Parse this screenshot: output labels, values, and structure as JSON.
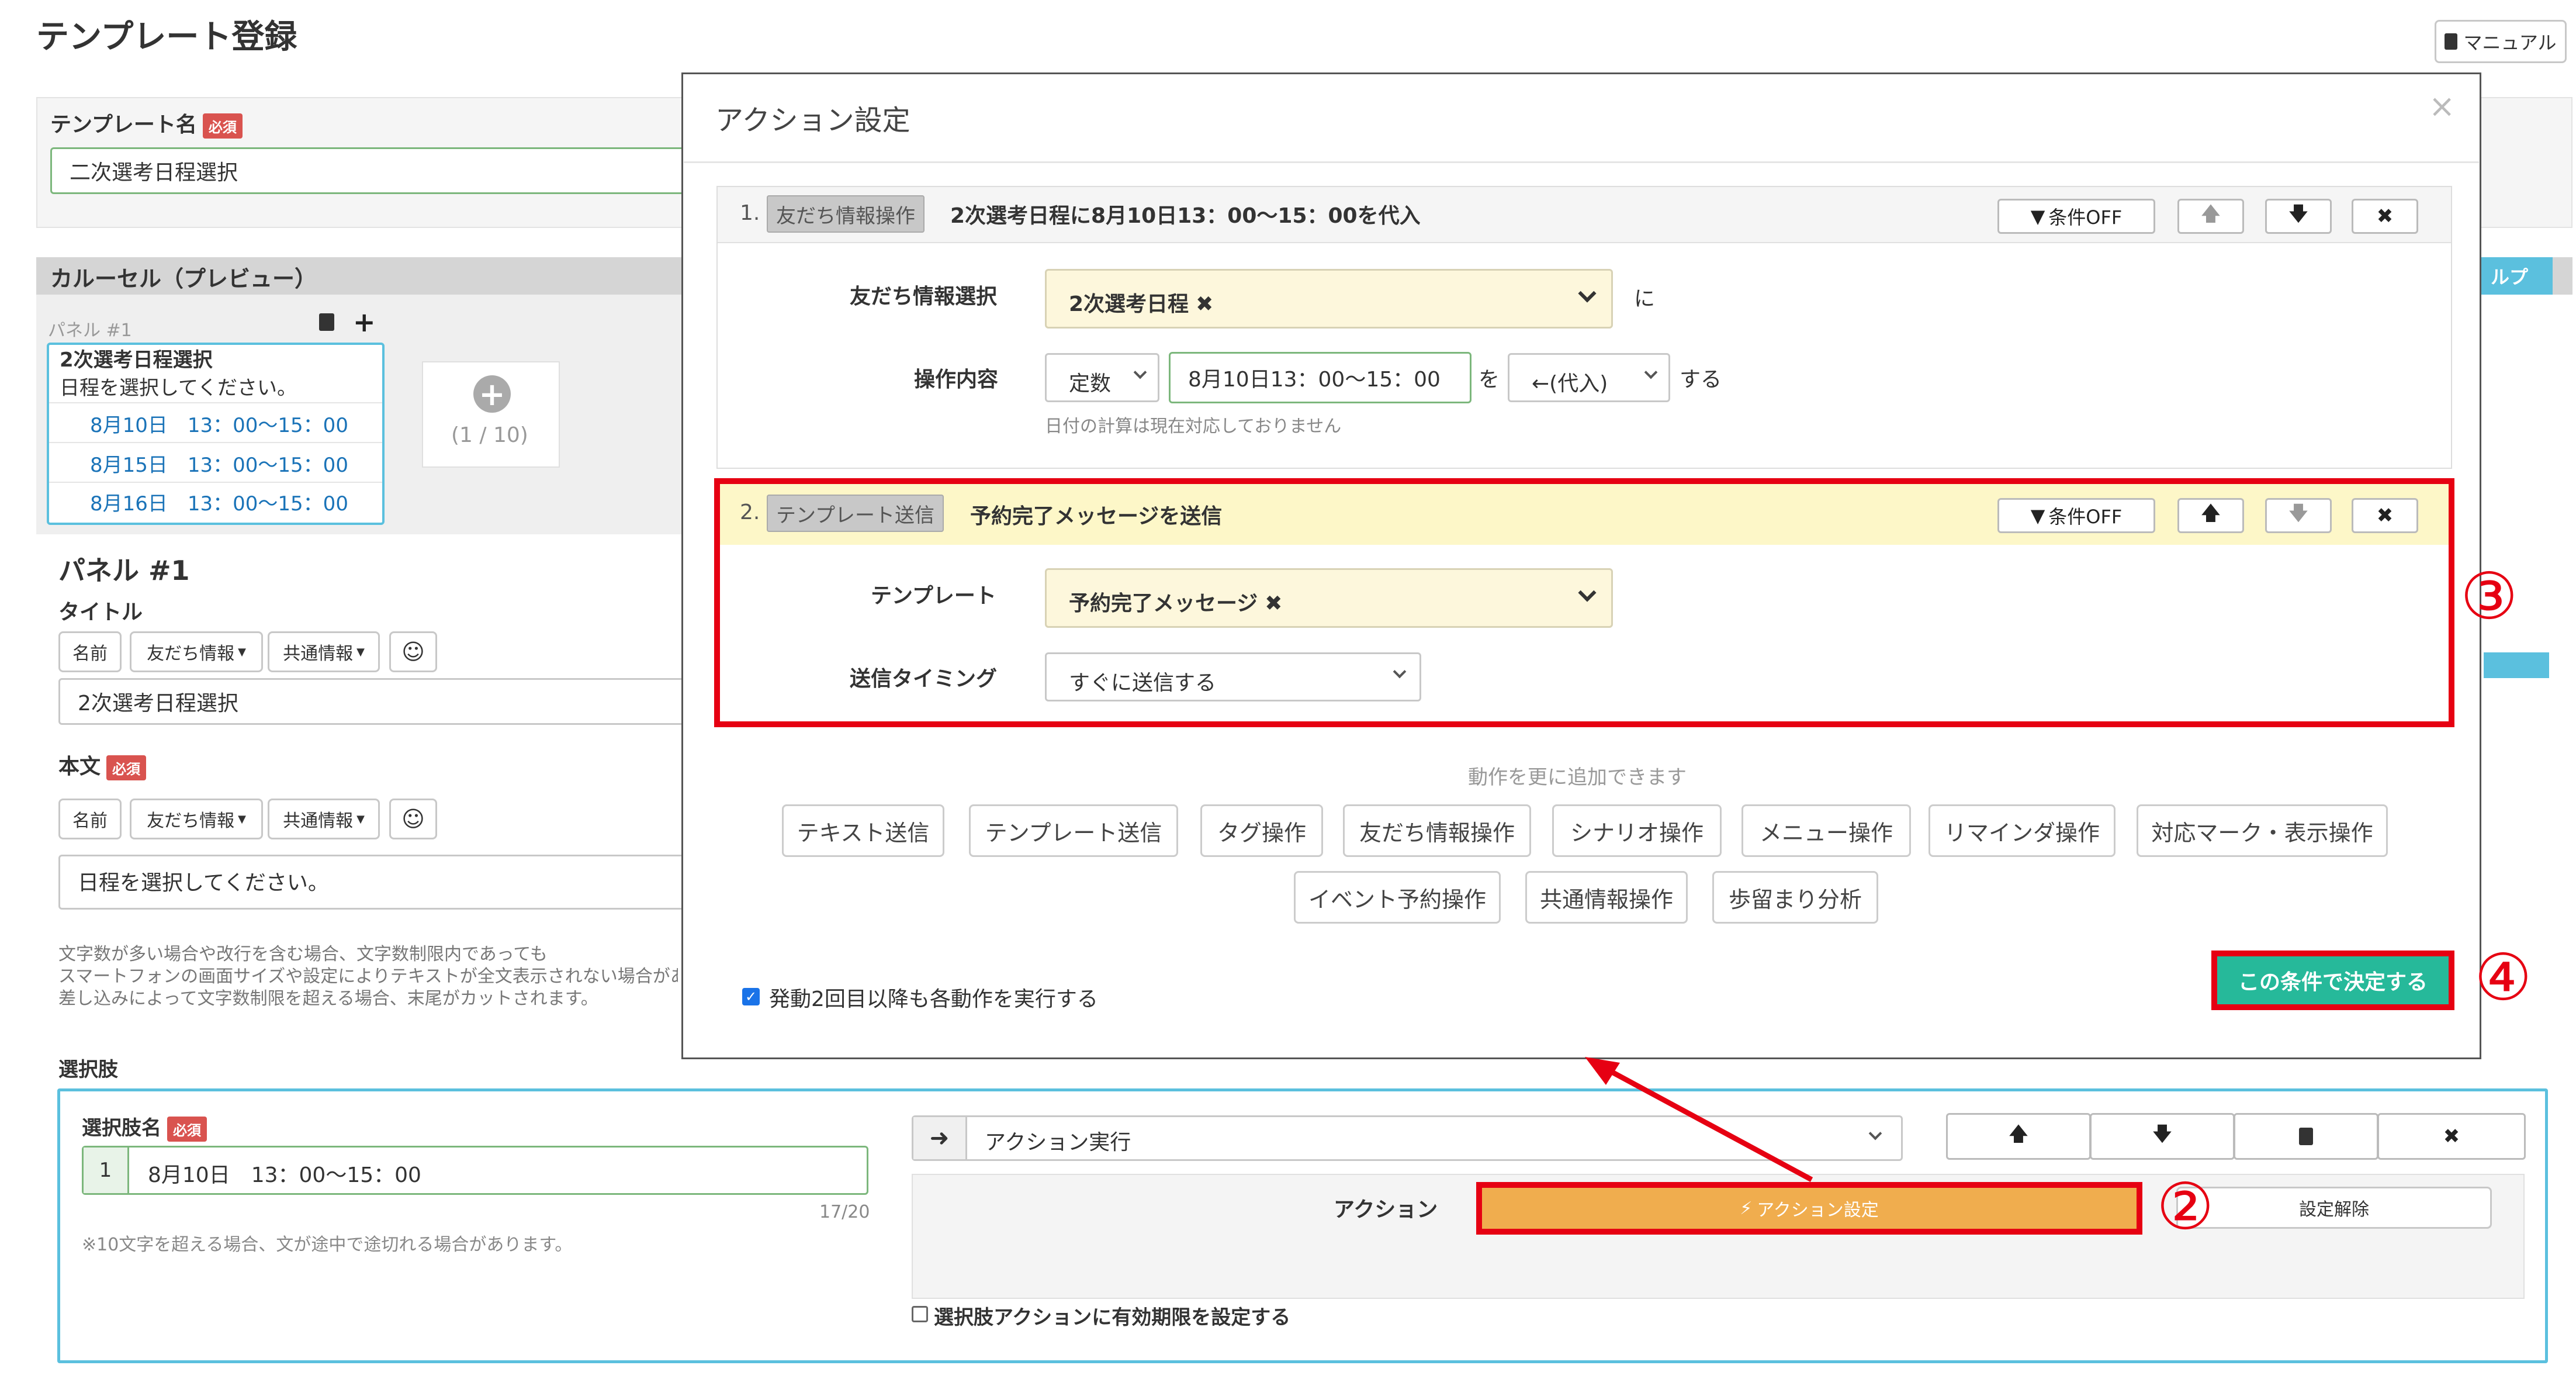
{
  "page": {
    "title": "テンプレート登録",
    "manual_label": "マニュアル",
    "template_name_label": "テンプレート名",
    "required": "必須",
    "template_name_value": "二次選考日程選択",
    "carousel_label": "カルーセル（プレビュー）",
    "help_label": "ルプ",
    "panel_small_label": "パネル #1",
    "preview_card": {
      "title": "2次選考日程選択",
      "subtitle": "日程を選択してください。",
      "options": [
        "8月10日　13：00〜15：00",
        "8月15日　13：00〜15：00",
        "8月16日　13：00〜15：00"
      ]
    },
    "add_panel_count": "(1 / 10)",
    "panel_heading": "パネル #1",
    "title_label": "タイトル",
    "insert_buttons": [
      "名前",
      "友だち情報",
      "共通情報"
    ],
    "title_value": "2次選考日程選択",
    "body_label": "本文",
    "body_value": "日程を選択してください。",
    "note_lines": [
      "文字数が多い場合や改行を含む場合、文字数制限内であっても",
      "スマートフォンの画面サイズや設定によりテキストが全文表示されない場合があり",
      "差し込みによって文字数制限を超える場合、末尾がカットされます。"
    ],
    "choices_label": "選択肢",
    "choice_name_label": "選択肢名",
    "choice_number": "1",
    "choice_value": "8月10日　13：00〜15：00",
    "choice_count": "17/20",
    "choice_note": "※10文字を超える場合、文が途中で途切れる場合があります。",
    "action_select_value": "アクション実行",
    "action_label": "アクション",
    "action_settings_button": "アクション設定",
    "action_release_button": "設定解除",
    "expiry_checkbox_label": "選択肢アクションに有効期限を設定する"
  },
  "modal": {
    "title": "アクション設定",
    "condition_off": "条件OFF",
    "action1": {
      "num": "1.",
      "tag": "友だち情報操作",
      "summary": "2次選考日程に8月10日13：00〜15：00を代入",
      "field_label": "友だち情報選択",
      "field_value": "2次選考日程",
      "field_suffix": "に",
      "op_label": "操作内容",
      "op_type": "定数",
      "op_value": "8月10日13：00〜15：00",
      "op_wo": "を",
      "op_mode": "←(代入)",
      "op_suru": "する",
      "op_note": "日付の計算は現在対応しておりません"
    },
    "action2": {
      "num": "2.",
      "tag": "テンプレート送信",
      "summary": "予約完了メッセージを送信",
      "template_label": "テンプレート",
      "template_value": "予約完了メッセージ",
      "timing_label": "送信タイミング",
      "timing_value": "すぐに送信する"
    },
    "add_more_text": "動作を更に追加できます",
    "action_types_row1": [
      "テキスト送信",
      "テンプレート送信",
      "タグ操作",
      "友だち情報操作",
      "シナリオ操作",
      "メニュー操作",
      "リマインダ操作",
      "対応マーク・表示操作"
    ],
    "action_types_row2": [
      "イベント予約操作",
      "共通情報操作",
      "歩留まり分析"
    ],
    "repeat_checkbox_label": "発動2回目以降も各動作を実行する",
    "decide_button": "この条件で決定する"
  },
  "annotations": {
    "circle2": "②",
    "circle3": "③",
    "circle4": "④",
    "highlight_color": "#e60012"
  }
}
